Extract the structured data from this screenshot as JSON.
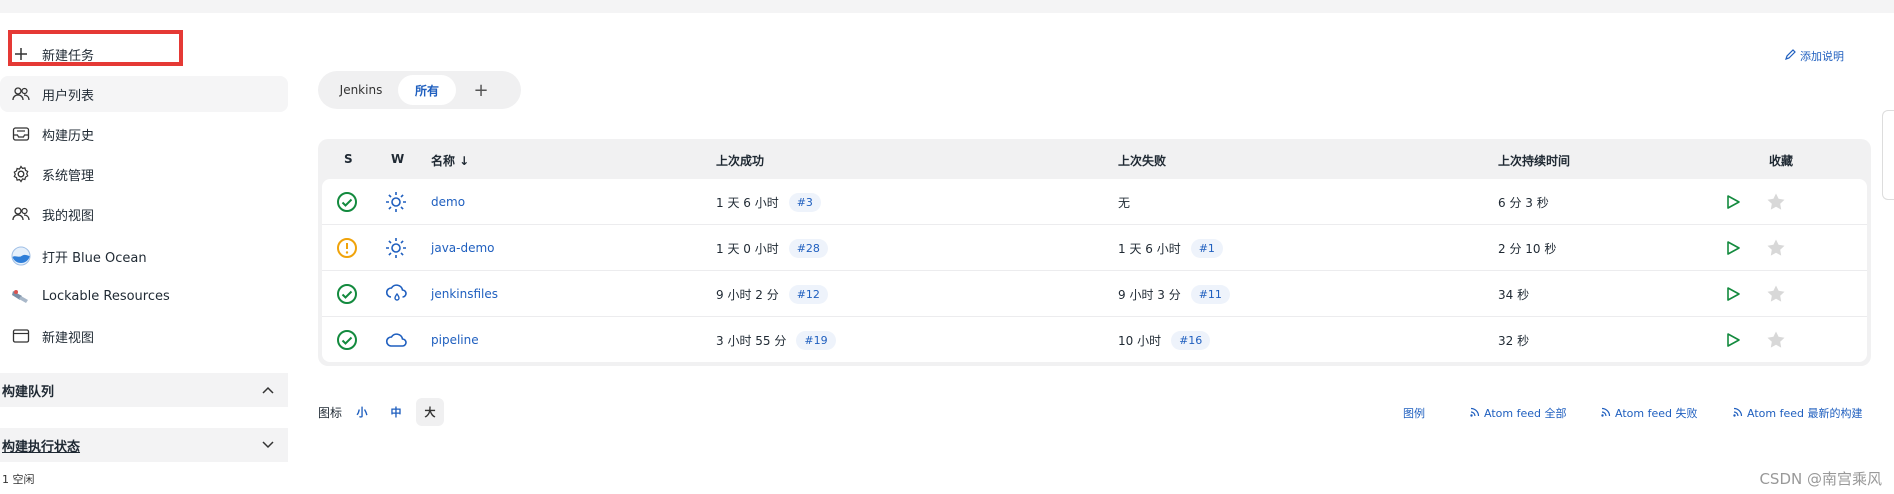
{
  "sidebar": {
    "items": [
      {
        "label": "新建任务",
        "icon": "plus-icon"
      },
      {
        "label": "用户列表",
        "icon": "users-icon"
      },
      {
        "label": "构建历史",
        "icon": "history-icon"
      },
      {
        "label": "系统管理",
        "icon": "gear-icon"
      },
      {
        "label": "我的视图",
        "icon": "users-icon"
      },
      {
        "label": "打开 Blue Ocean",
        "icon": "blue-ocean-icon"
      },
      {
        "label": "Lockable Resources",
        "icon": "lock-resources-icon"
      },
      {
        "label": "新建视图",
        "icon": "folder-icon"
      }
    ],
    "build_queue": "构建队列",
    "executor_status": "构建执行状态",
    "idle_text": "1  空闲"
  },
  "header": {
    "add_description": "添加说明"
  },
  "tabs": [
    {
      "label": "Jenkins"
    },
    {
      "label": "所有",
      "active": true
    },
    {
      "label": "+"
    }
  ],
  "table": {
    "headers": {
      "s": "S",
      "w": "W",
      "name": "名称 ↓",
      "last_success": "上次成功",
      "last_failure": "上次失败",
      "last_duration": "上次持续时间",
      "favorite": "收藏"
    },
    "rows": [
      {
        "status": "success",
        "weather": "sunny",
        "name": "demo",
        "last_success": "1 天 6 小时",
        "success_build": "#3",
        "last_failure": "无",
        "failure_build": "",
        "duration": "6 分 3 秒"
      },
      {
        "status": "unstable",
        "weather": "sunny",
        "name": "java-demo",
        "last_success": "1 天 0 小时",
        "success_build": "#28",
        "last_failure": "1 天 6 小时",
        "failure_build": "#1",
        "duration": "2 分 10 秒"
      },
      {
        "status": "success",
        "weather": "rainy",
        "name": "jenkinsfiles",
        "last_success": "9 小时 2 分",
        "success_build": "#12",
        "last_failure": "9 小时 3 分",
        "failure_build": "#11",
        "duration": "34 秒"
      },
      {
        "status": "success",
        "weather": "cloudy",
        "name": "pipeline",
        "last_success": "3 小时 55 分",
        "success_build": "#19",
        "last_failure": "10 小时",
        "failure_build": "#16",
        "duration": "32 秒"
      }
    ]
  },
  "footer": {
    "icon_label": "图标",
    "sizes": [
      "小",
      "中",
      "大"
    ],
    "legend": "图例",
    "feeds": [
      "Atom feed 全部",
      "Atom feed 失败",
      "Atom feed 最新的构建"
    ],
    "watermark": "CSDN @南宫乘风"
  },
  "colors": {
    "accent": "#1f5fbf",
    "success": "#138a3e",
    "unstable": "#f0a30a",
    "highlight": "#e53935"
  }
}
